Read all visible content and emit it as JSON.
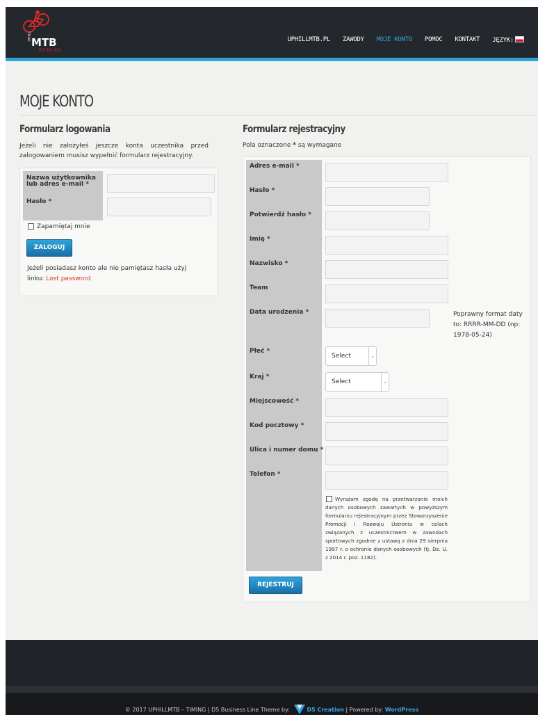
{
  "header": {
    "logo": {
      "main_text": "MTB",
      "sub_text": "BESKIDY",
      "side_text": "UPHILL"
    },
    "nav": [
      {
        "label": "UPHILLMTB.PL",
        "active": false
      },
      {
        "label": "ZAWODY",
        "active": false
      },
      {
        "label": "MOJE KONTO",
        "active": true
      },
      {
        "label": "POMOC",
        "active": false
      },
      {
        "label": "KONTAKT",
        "active": false
      },
      {
        "label": "JĘZYK:",
        "active": false
      }
    ],
    "accent_color": "#2ba3d7",
    "active_nav_color": "#33a6e3"
  },
  "page": {
    "title": "MOJE KONTO"
  },
  "login": {
    "heading": "Formularz logowania",
    "intro": "Jeżeli nie założyłeś jeszcze konta uczestnika przed zalogowaniem musisz wypełnić formularz rejestracyjny.",
    "username_label": "Nazwa użytkownika lub adres e-mail *",
    "password_label": "Hasło *",
    "username_value": "",
    "password_value": "",
    "remember_label": "Zapamiętaj mnie",
    "submit_label": "ZALOGUJ",
    "forgot_text": "Jeżeli posiadasz konto ale nie pamiętasz hasła użyj linku: ",
    "forgot_link": "Lost password",
    "link_color": "#d9391b"
  },
  "register": {
    "heading": "Formularz rejestracyjny",
    "required_prefix": "Pola oznaczone ",
    "required_star": "*",
    "required_suffix": " są wymagane",
    "fields": {
      "email": "Adres e-mail *",
      "password": "Hasło *",
      "password_confirm": "Potwierdź hasło *",
      "first_name": "Imię *",
      "last_name": "Nazwisko *",
      "team": "Team",
      "birth_date": "Data urodzenia *",
      "gender": "Płeć *",
      "country": "Kraj *",
      "city": "Miejscowość *",
      "postal_code": "Kod pocztowy *",
      "street": "Ulica i numer domu *",
      "phone": "Telefon *"
    },
    "date_hint": "Poprawny format daty to: RRRR-MM-DD (np: 1978-05-24)",
    "gender_select": "Select",
    "country_select": "Select",
    "consent": "Wyrażam zgodę na przetwarzanie moich danych osobowych zawartych w powyższym formularzu rejestracyjnym przez Stowarzyszenie Promocji i Rozwoju Ustronia w celach związanych z uczestnictwem w zawodach sportowych zgodnie z ustawą z dnia 29 sierpnia 1997 r. o ochronie danych osobowych (tj. Dz. U. z 2014 r. poz. 1182).",
    "submit_label": "REJESTRUJ"
  },
  "footer": {
    "copyright": "© 2017 UPHILLMTB – TIMING | D5 Business Line Theme by: ",
    "d5_link": "D5 Creation",
    "powered": " | Powered by: ",
    "wp_link": "WordPress"
  }
}
